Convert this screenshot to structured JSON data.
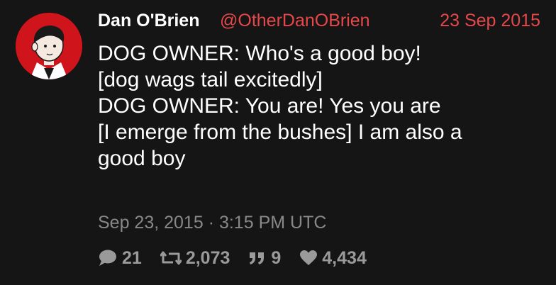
{
  "tweet": {
    "fullname": "Dan O'Brien",
    "username": "@OtherDanOBrien",
    "date": "23 Sep 2015",
    "lines": [
      "DOG OWNER: Who's a good boy!",
      "[dog wags tail excitedly]",
      "DOG OWNER: You are! Yes you are",
      "[I emerge from the bushes] I am also a",
      "good boy"
    ],
    "published": "Sep 23, 2015 · 3:15 PM UTC",
    "stats": {
      "comments": "21",
      "retweets": "2,073",
      "quotes": "9",
      "likes": "4,434"
    },
    "icons": {
      "comment": "comment-icon",
      "retweet": "retweet-icon",
      "quote": "quote-icon",
      "like": "heart-icon"
    },
    "colors": {
      "background": "#151515",
      "accent": "#e6484a",
      "muted": "#888888",
      "text": "#ffffff",
      "avatar_bg": "#d0141c"
    }
  }
}
